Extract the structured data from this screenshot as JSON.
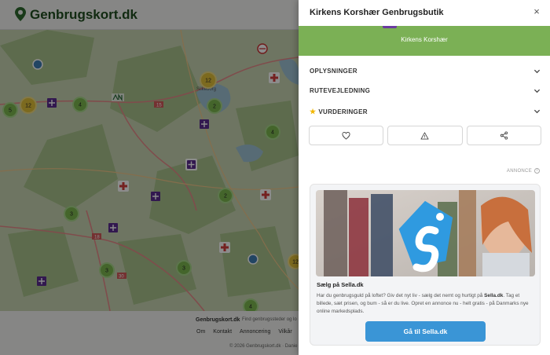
{
  "site": {
    "brand": "Genbrugskort.dk",
    "footer": {
      "brand": "Genbrugskort.dk",
      "tagline": "Find genbrugssteder og lo",
      "links": [
        "Om",
        "Kontakt",
        "Annoncering",
        "Vilkår"
      ],
      "copyright": "© 2026 Genbrugskort.dk · Danie"
    }
  },
  "map": {
    "town_label": "Silkeborg",
    "clusters": [
      "5",
      "12",
      "4",
      "12",
      "2",
      "4",
      "2",
      "3",
      "3",
      "3",
      "4",
      "12"
    ],
    "road_numbers": [
      "15",
      "18",
      "30"
    ]
  },
  "panel": {
    "title": "Kirkens Korshær Genbrugsbutik",
    "close_label": "×",
    "store_name": "Kirkens Korshær",
    "accent_color": "#7bb055",
    "sections": [
      "OPLYSNINGER",
      "RUTEVEJLEDNING",
      "VURDERINGER"
    ],
    "actions": [
      "heart-icon",
      "warning-icon",
      "share-icon"
    ],
    "ad_label": "ANNONCE",
    "ad": {
      "heading": "Sælg på Sella.dk",
      "body_1": "Har du genbrugsguld på loftet? Giv det nyt liv - sælg det nemt og hurtigt på ",
      "body_bold": "Sella.dk",
      "body_2": ". Tag et billede, sæt prisen, og bum - så er du live. Opret en annonce nu - helt gratis - på Danmarks nye online markedsplads.",
      "button": "Gå til Sella.dk",
      "button_color": "#3a95d6"
    }
  }
}
